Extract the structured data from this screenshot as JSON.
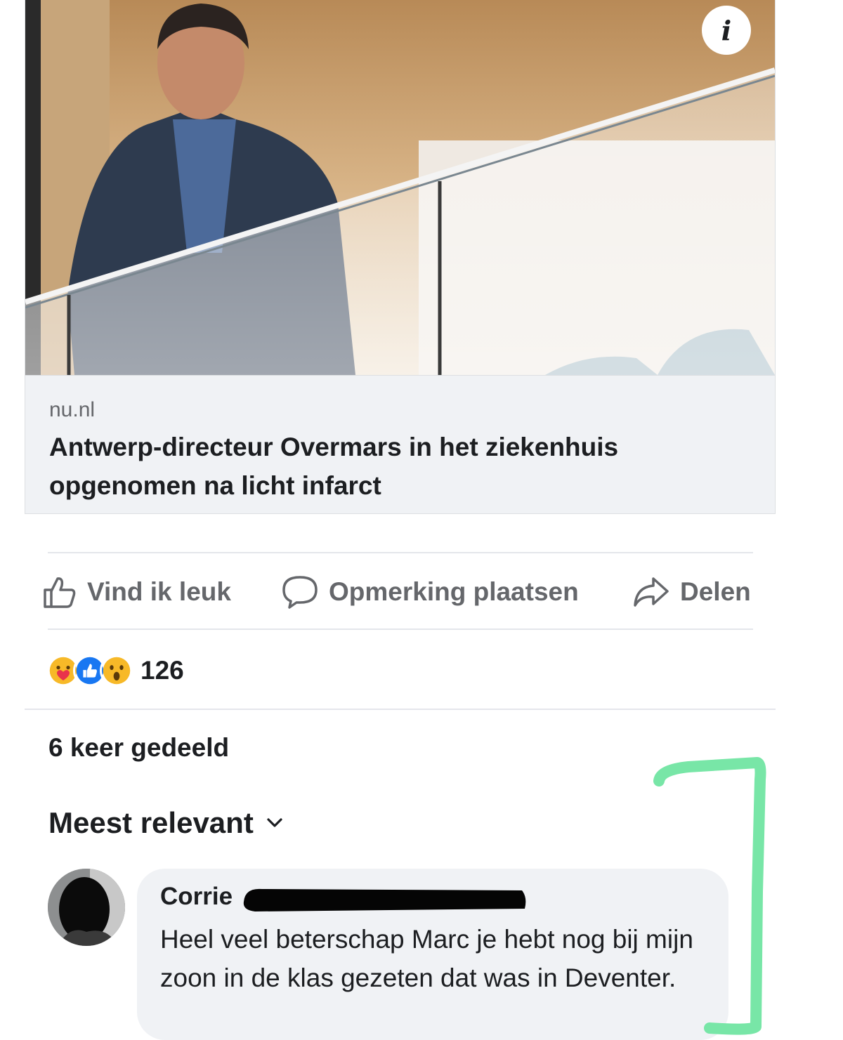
{
  "link_preview": {
    "info_label": "i",
    "domain": "nu.nl",
    "headline": "Antwerp-directeur Overmars in het ziekenhuis opgenomen na licht infarct"
  },
  "actions": {
    "like": "Vind ik leuk",
    "comment": "Opmerking plaatsen",
    "share": "Delen"
  },
  "reactions": {
    "types": [
      "care",
      "like",
      "wow"
    ],
    "count": "126"
  },
  "shares": "6 keer gedeeld",
  "sort": {
    "label": "Meest relevant"
  },
  "comment": {
    "author": "Corrie",
    "text": "Heel veel beterschap Marc je hebt nog bij mijn zoon in de klas gezeten dat was in Deventer."
  },
  "colors": {
    "text": "#1c1e21",
    "secondary": "#65676b",
    "bubble": "#f0f2f5",
    "like_blue": "#1877f2",
    "annotation_green": "#78e6a7"
  },
  "icons": [
    "info-icon",
    "like-icon",
    "comment-icon",
    "share-icon",
    "chevron-down-icon"
  ]
}
